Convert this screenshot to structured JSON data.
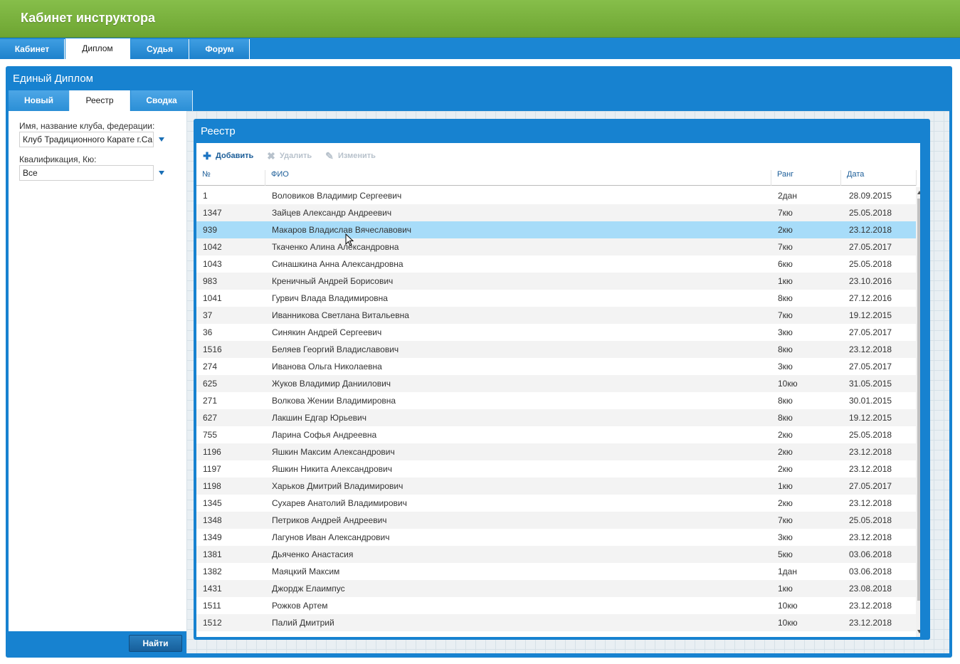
{
  "header": {
    "title": "Кабинет инструктора"
  },
  "nav": {
    "tabs": [
      "Кабинет",
      "Диплом",
      "Судья",
      "Форум"
    ],
    "active": "Диплом"
  },
  "panel": {
    "title": "Единый Диплом",
    "subtabs": [
      "Новый",
      "Реестр",
      "Сводка"
    ],
    "active_subtab": "Реестр"
  },
  "filters": {
    "club_label": "Имя, название клуба, федерации:",
    "club_value": "Клуб Традиционного Карате г.Са",
    "qual_label": "Квалификация, Кю:",
    "qual_value": "Все",
    "find_label": "Найти"
  },
  "registry": {
    "title": "Реестр",
    "toolbar": {
      "add": "Добавить",
      "delete": "Удалить",
      "edit": "Изменить"
    },
    "columns": {
      "num": "№",
      "fio": "ФИО",
      "rank": "Ранг",
      "date": "Дата"
    },
    "selected_index": 2,
    "rows": [
      [
        "1",
        "Воловиков Владимир Сергеевич",
        "2дан",
        "28.09.2015"
      ],
      [
        "1347",
        "Зайцев Александр Андреевич",
        "7кю",
        "25.05.2018"
      ],
      [
        "939",
        "Макаров Владислав Вячеславович",
        "2кю",
        "23.12.2018"
      ],
      [
        "1042",
        "Ткаченко Алина Александровна",
        "7кю",
        "27.05.2017"
      ],
      [
        "1043",
        "Синашкина Анна Александровна",
        "6кю",
        "25.05.2018"
      ],
      [
        "983",
        "Креничный Андрей Борисович",
        "1кю",
        "23.10.2016"
      ],
      [
        "1041",
        "Гурвич Влада Владимировна",
        "8кю",
        "27.12.2016"
      ],
      [
        "37",
        "Иванникова Светлана Витальевна",
        "7кю",
        "19.12.2015"
      ],
      [
        "36",
        "Синякин Андрей Сергеевич",
        "3кю",
        "27.05.2017"
      ],
      [
        "1516",
        "Беляев Георгий Владиславович",
        "8кю",
        "23.12.2018"
      ],
      [
        "274",
        "Иванова Ольга Николаевна",
        "3кю",
        "27.05.2017"
      ],
      [
        "625",
        "Жуков Владимир Даниилович",
        "10кю",
        "31.05.2015"
      ],
      [
        "271",
        "Волкова Жении Владимировна",
        "8кю",
        "30.01.2015"
      ],
      [
        "627",
        "Лакшин Едгар Юрьевич",
        "8кю",
        "19.12.2015"
      ],
      [
        "755",
        "Ларина Софья Андреевна",
        "2кю",
        "25.05.2018"
      ],
      [
        "1196",
        "Яшкин Максим Александрович",
        "2кю",
        "23.12.2018"
      ],
      [
        "1197",
        "Яшкин Никита Александрович",
        "2кю",
        "23.12.2018"
      ],
      [
        "1198",
        "Харьков Дмитрий Владимирович",
        "1кю",
        "27.05.2017"
      ],
      [
        "1345",
        "Сухарев Анатолий Владимирович",
        "2кю",
        "23.12.2018"
      ],
      [
        "1348",
        "Петриков Андрей Андреевич",
        "7кю",
        "25.05.2018"
      ],
      [
        "1349",
        "Лагунов Иван Александрович",
        "3кю",
        "23.12.2018"
      ],
      [
        "1381",
        "Дьяченко Анастасия",
        "5кю",
        "03.06.2018"
      ],
      [
        "1382",
        "Маяцкий Максим",
        "1дан",
        "03.06.2018"
      ],
      [
        "1431",
        "Джордж Елаимпус",
        "1кю",
        "23.08.2018"
      ],
      [
        "1511",
        "Рожков Артем",
        "10кю",
        "23.12.2018"
      ],
      [
        "1512",
        "Палий Дмитрий",
        "10кю",
        "23.12.2018"
      ]
    ]
  }
}
